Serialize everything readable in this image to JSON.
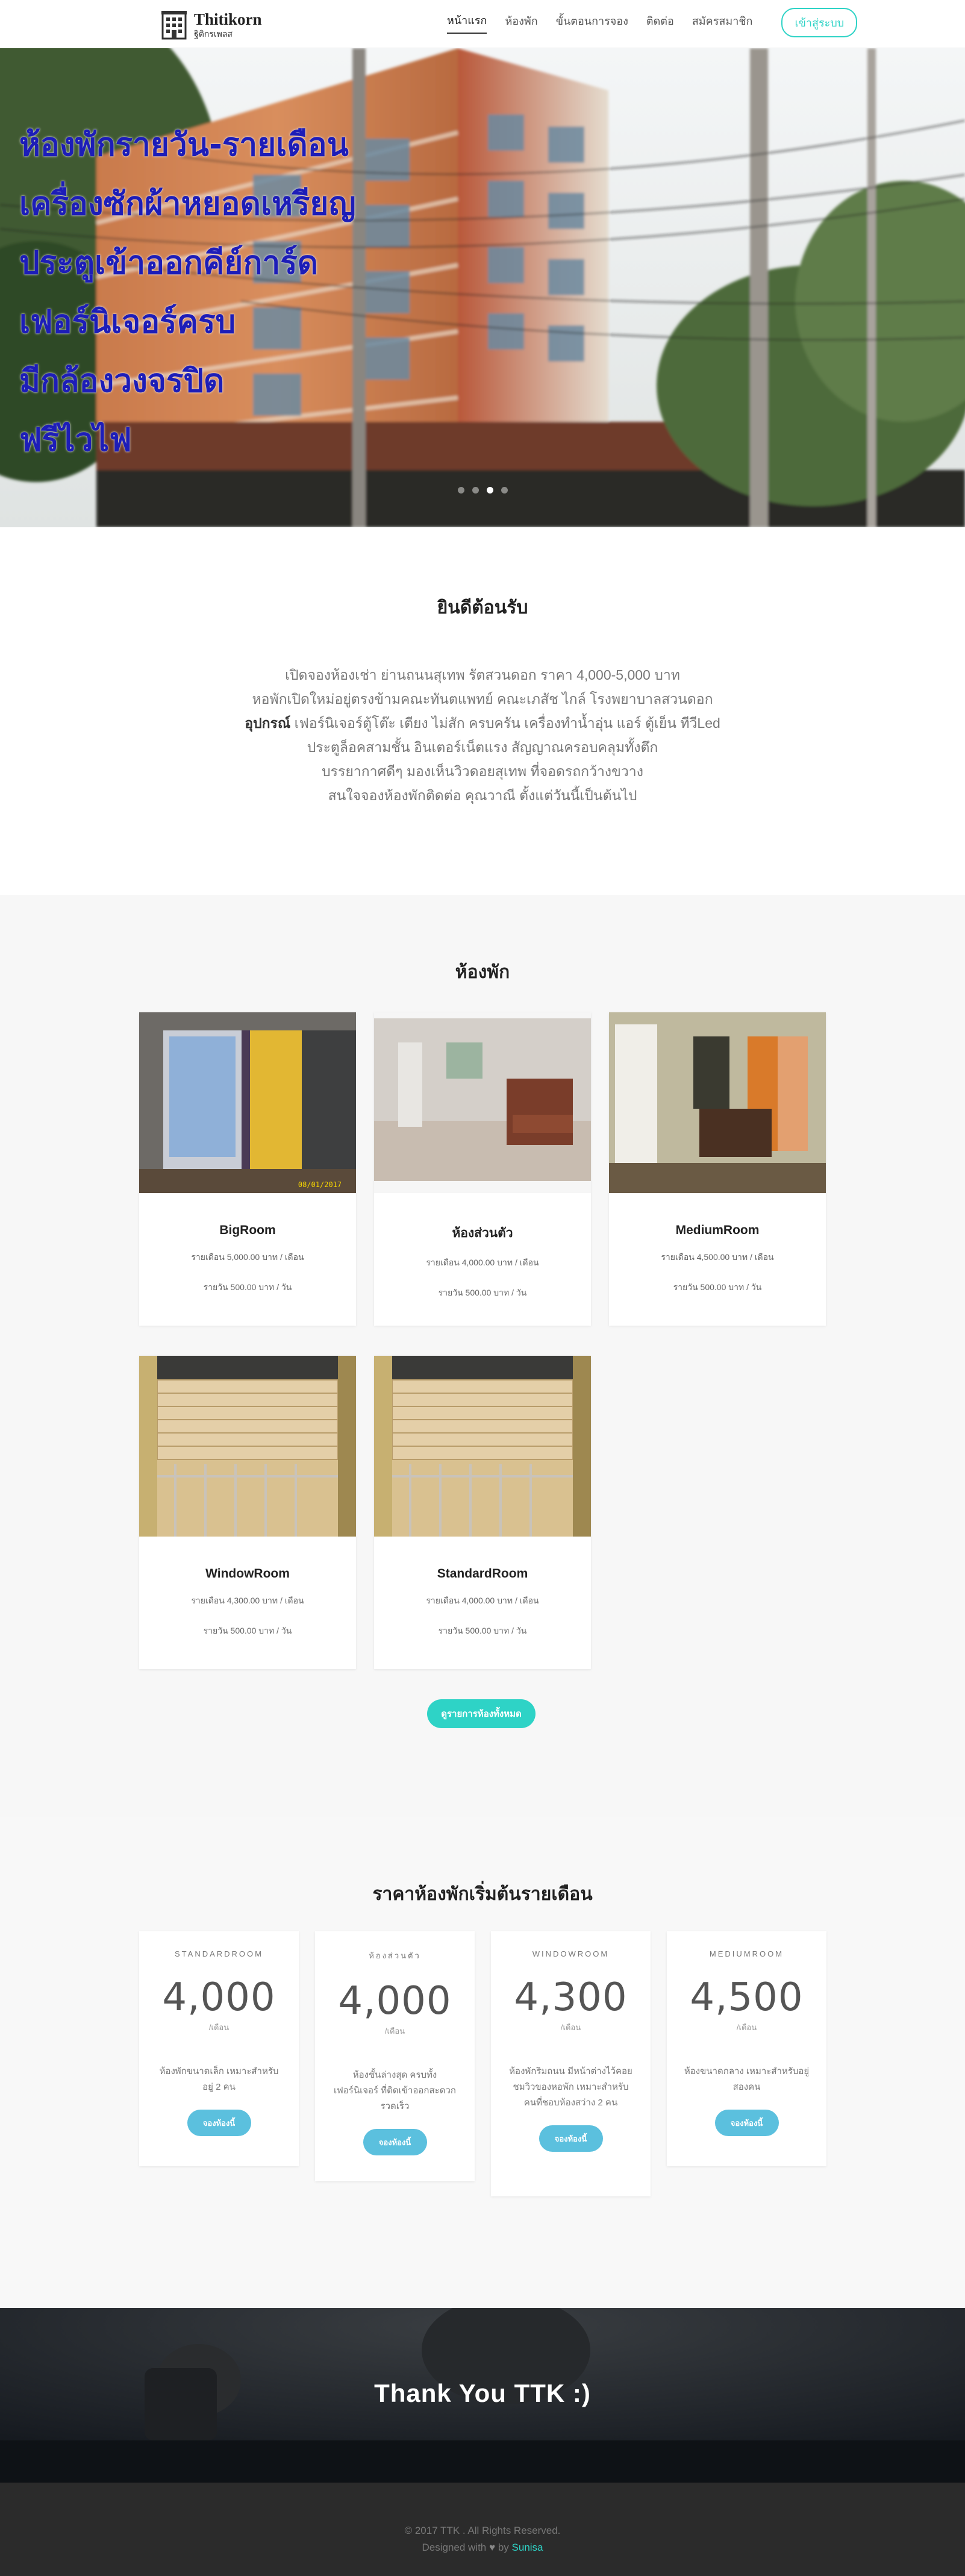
{
  "brand": {
    "name": "Thitikorn",
    "subtitle": "ฐิติกรเพลส"
  },
  "nav": {
    "items": [
      "หน้าแรก",
      "ห้องพัก",
      "ขั้นตอนการจอง",
      "ติดต่อ",
      "สมัครสมาชิก"
    ],
    "login": "เข้าสู่ระบบ"
  },
  "hero": {
    "lines": [
      "ห้องพักรายวัน-รายเดือน",
      "เครื่องซักผ้าหยอดเหรียญ",
      "ประตูเข้าออกคีย์การ์ด",
      "เฟอร์นิเจอร์ครบ",
      "มีกล้องวงจรปิด",
      "ฟรีไวไฟ"
    ],
    "slides_total": 4,
    "active_slide": 3
  },
  "welcome": {
    "title": "ยินดีต้อนรับ",
    "line1": "เปิดจองห้องเช่า ย่านถนนสุเทพ รัตสวนดอก ราคา 4,000-5,000 บาท",
    "line2": "หอพักเปิดใหม่อยู่ตรงข้ามคณะทันตแพทย์ คณะเภสัช ไกล์ โรงพยาบาลสวนดอก",
    "line3_bold": "อุปกรณ์",
    "line3_rest": " เฟอร์นิเจอร์ตู้โต๊ะ เตียง ไม่สัก ครบครัน เครื่องทำน้ำอุ่น แอร์ ตู้เย็น ทีวีLed",
    "line4": "ประตูล็อคสามชั้น อินเตอร์เน็ตแรง สัญญาณครอบคลุมทั้งตึก",
    "line5": "บรรยากาศดีๆ มองเห็นวิวดอยสุเทพ ที่จอดรถกว้างขวาง",
    "line6": "สนใจจองห้องพักติดต่อ คุณวาณี ตั้งแต่วันนี้เป็นต้นไป"
  },
  "rooms": {
    "title": "ห้องพัก",
    "cards": [
      {
        "name": "BigRoom",
        "monthly": "รายเดือน 5,000.00 บาท / เดือน",
        "daily": "รายวัน 500.00 บาท / วัน",
        "timestamp": "08/01/2017"
      },
      {
        "name": "ห้องส่วนตัว",
        "monthly": "รายเดือน 4,000.00 บาท / เดือน",
        "daily": "รายวัน 500.00 บาท / วัน"
      },
      {
        "name": "MediumRoom",
        "monthly": "รายเดือน 4,500.00 บาท / เดือน",
        "daily": "รายวัน 500.00 บาท / วัน"
      },
      {
        "name": "WindowRoom",
        "monthly": "รายเดือน 4,300.00 บาท / เดือน",
        "daily": "รายวัน 500.00 บาท / วัน"
      },
      {
        "name": "StandardRoom",
        "monthly": "รายเดือน 4,000.00 บาท / เดือน",
        "daily": "รายวัน 500.00 บาท / วัน"
      }
    ],
    "all_button": "ดูรายการห้องทั้งหมด"
  },
  "pricing": {
    "title": "ราคาห้องพักเริ่มต้นรายเดือน",
    "plans": [
      {
        "name": "STANDARDROOM",
        "price": "4,000",
        "unit": "/เดือน",
        "desc": "ห้องพักขนาดเล็ก เหมาะสำหรับอยู่ 2 คน",
        "button": "จองห้องนี้"
      },
      {
        "name": "ห้องส่วนตัว",
        "price": "4,000",
        "unit": "/เดือน",
        "desc": "ห้องชั้นล่างสุด ครบทั้งเฟอร์นิเจอร์ ที่ติดเข้าออกสะดวกรวดเร็ว",
        "button": "จองห้องนี้"
      },
      {
        "name": "WINDOWROOM",
        "price": "4,300",
        "unit": "/เดือน",
        "desc": "ห้องพักริมถนน มีหน้าต่างไว้คอยชมวิวของหอพัก เหมาะสำหรับคนที่ชอบห้องสว่าง 2 คน",
        "button": "จองห้องนี้"
      },
      {
        "name": "MEDIUMROOM",
        "price": "4,500",
        "unit": "/เดือน",
        "desc": "ห้องขนาดกลาง เหมาะสำหรับอยู่สองคน",
        "button": "จองห้องนี้"
      }
    ]
  },
  "thanks": {
    "text": "Thank You TTK :)"
  },
  "footer": {
    "copyright": "© 2017 TTK . All Rights Reserved.",
    "designed_prefix": "Designed with",
    "heart": "♥",
    "by": "by",
    "author": "Sunisa"
  },
  "colors": {
    "accent": "#2ed3c6",
    "plan_button": "#5bc0de",
    "hero_text": "#1d1db8",
    "footer_bg": "#2b2b2b"
  }
}
